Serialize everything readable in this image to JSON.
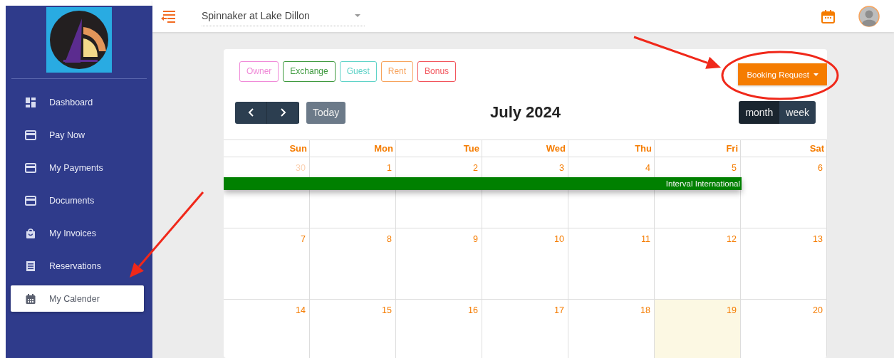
{
  "sidebar": {
    "items": [
      {
        "label": "Dashboard",
        "selected": false
      },
      {
        "label": "Pay Now",
        "selected": false
      },
      {
        "label": "My Payments",
        "selected": false
      },
      {
        "label": "Documents",
        "selected": false
      },
      {
        "label": "My Invoices",
        "selected": false
      },
      {
        "label": "Reservations",
        "selected": false
      },
      {
        "label": "My Calender",
        "selected": true
      }
    ]
  },
  "topbar": {
    "property_select": {
      "value": "Spinnaker at Lake Dillon"
    }
  },
  "legend": [
    {
      "label": "Owner",
      "color": "#f08ad8"
    },
    {
      "label": "Exchange",
      "color": "#3f9a3f"
    },
    {
      "label": "Guest",
      "color": "#5fd3c8"
    },
    {
      "label": "Rent",
      "color": "#f7a35c"
    },
    {
      "label": "Bonus",
      "color": "#f2545b"
    }
  ],
  "booking_button": {
    "label": "Booking Request"
  },
  "toolbar": {
    "today": "Today",
    "title": "July 2024",
    "views": [
      {
        "label": "month",
        "selected": true
      },
      {
        "label": "week",
        "selected": false
      }
    ]
  },
  "calendar": {
    "weekdays": [
      "Sun",
      "Mon",
      "Tue",
      "Wed",
      "Thu",
      "Fri",
      "Sat"
    ],
    "weeks": [
      {
        "days": [
          {
            "date": "30",
            "other_month": true,
            "today": false
          },
          {
            "date": "1",
            "other_month": false,
            "today": false
          },
          {
            "date": "2",
            "other_month": false,
            "today": false
          },
          {
            "date": "3",
            "other_month": false,
            "today": false
          },
          {
            "date": "4",
            "other_month": false,
            "today": false
          },
          {
            "date": "5",
            "other_month": false,
            "today": false
          },
          {
            "date": "6",
            "other_month": false,
            "today": false
          }
        ],
        "events": [
          {
            "title": "Interval International",
            "color": "#008000"
          }
        ]
      },
      {
        "days": [
          {
            "date": "7",
            "other_month": false,
            "today": false
          },
          {
            "date": "8",
            "other_month": false,
            "today": false
          },
          {
            "date": "9",
            "other_month": false,
            "today": false
          },
          {
            "date": "10",
            "other_month": false,
            "today": false
          },
          {
            "date": "11",
            "other_month": false,
            "today": false
          },
          {
            "date": "12",
            "other_month": false,
            "today": false
          },
          {
            "date": "13",
            "other_month": false,
            "today": false
          }
        ]
      },
      {
        "days": [
          {
            "date": "14",
            "other_month": false,
            "today": false
          },
          {
            "date": "15",
            "other_month": false,
            "today": false
          },
          {
            "date": "16",
            "other_month": false,
            "today": false
          },
          {
            "date": "17",
            "other_month": false,
            "today": false
          },
          {
            "date": "18",
            "other_month": false,
            "today": false
          },
          {
            "date": "19",
            "other_month": false,
            "today": true
          },
          {
            "date": "20",
            "other_month": false,
            "today": false
          }
        ]
      }
    ]
  },
  "annotations": [
    {
      "kind": "arrow"
    },
    {
      "kind": "ellipse"
    },
    {
      "kind": "arrow"
    }
  ]
}
